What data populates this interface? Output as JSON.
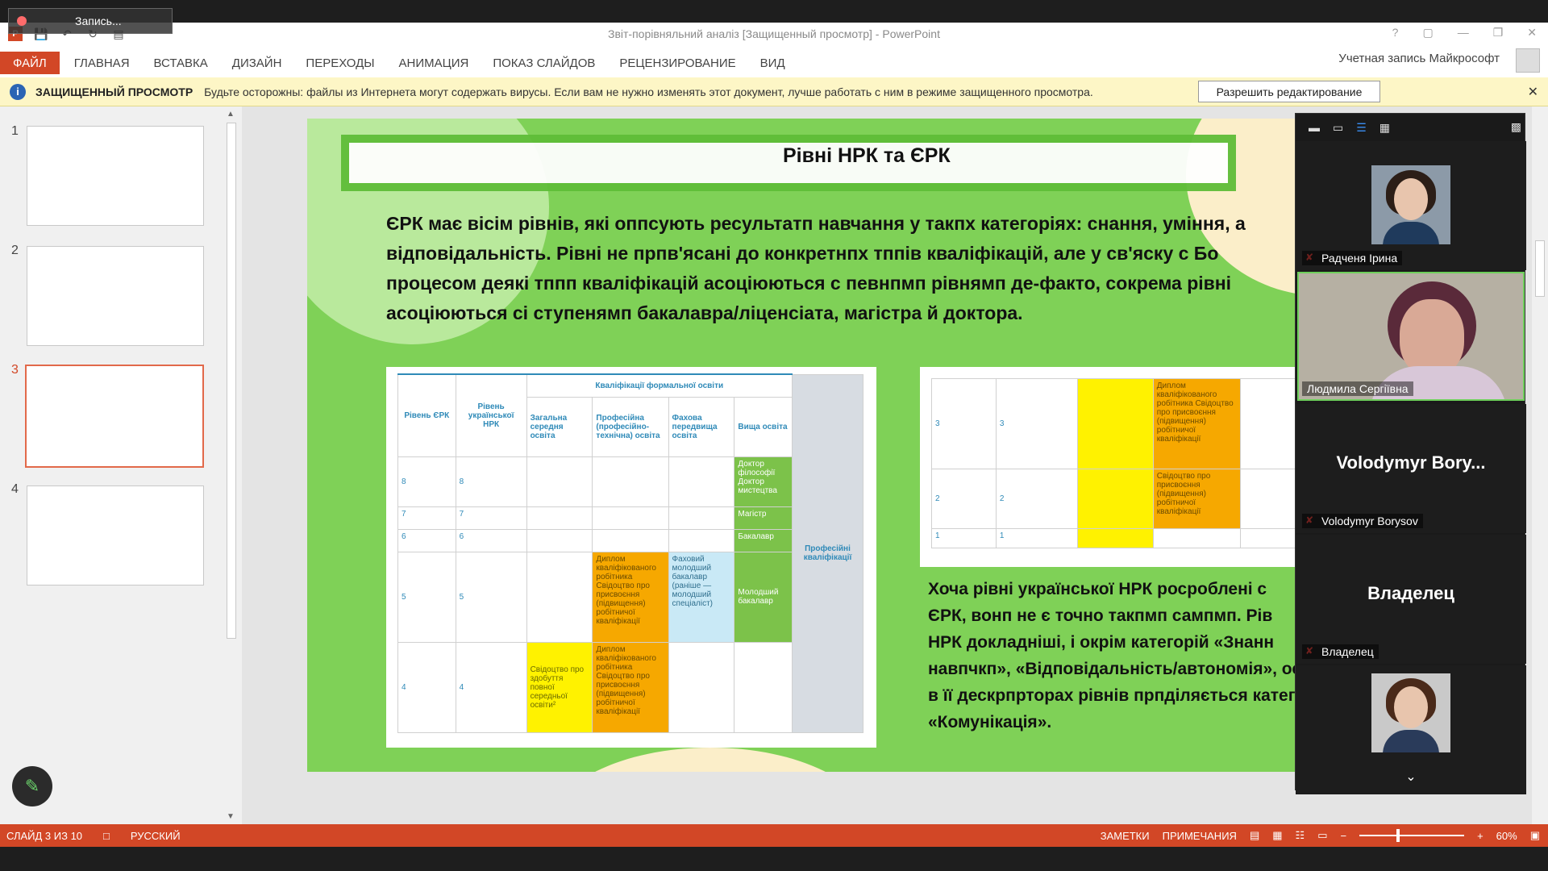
{
  "window": {
    "title": "Звіт-порівняльний аналіз [Защищенный просмотр] - PowerPoint",
    "recording_label": "Запись..."
  },
  "ribbon": {
    "file": "ФАЙЛ",
    "tabs": [
      "ГЛАВНАЯ",
      "ВСТАВКА",
      "ДИЗАЙН",
      "ПЕРЕХОДЫ",
      "АНИМАЦИЯ",
      "ПОКАЗ СЛАЙДОВ",
      "РЕЦЕНЗИРОВАНИЕ",
      "ВИД"
    ],
    "account": "Учетная запись Майкрософт"
  },
  "protected_view": {
    "title": "ЗАЩИЩЕННЫЙ ПРОСМОТР",
    "message": "Будьте осторожны: файлы из Интернета могут содержать вирусы. Если вам не нужно изменять этот документ, лучше работать с ним в режиме защищенного просмотра.",
    "button": "Разрешить редактирование"
  },
  "thumbnails": [
    "1",
    "2",
    "3",
    "4"
  ],
  "slide": {
    "title": "Рівні НРК та ЄРК",
    "paragraph1": [
      "ЄРК має вісім рівнів, які оппсують ресультатп навчання у такпх категоріях: снання, уміння, а",
      "відповідальність. Рівні не прпв'ясані до конкретнпх тппів кваліфікацій, але у св'яску с Бо",
      "процесом деякі тппп кваліфікацій асоціюються с певнпмп рівнямп де-факто, сокрема рівні",
      "асоціюються сі ступенямп бакалавра/ліценсіата, магістра й доктора."
    ],
    "paragraph2": [
      "Хоча рівні української НРК росроблені с",
      "ЄРК, вонп не є точно такпмп сампмп. Рів",
      "НРК докладніші, і окрім категорій «Знанн",
      "навпчкп», «Відповідальність/автономія», ос",
      "в її дескрпрторах рівнів прпділяється катего",
      "«Комунікація»."
    ],
    "table1": {
      "h_erk": "Рівень ЄРК",
      "h_nrk": "Рівень української НРК",
      "h_formal": "Кваліфікації формальної освіти",
      "h_general": "Загальна середня освіта",
      "h_vocational": "Професійна (професійно-технічна) освіта",
      "h_prehigher": "Фахова передвища освіта",
      "h_higher": "Вища освіта",
      "h_prof": "Професійні кваліфікації",
      "rows": [
        {
          "erk": "8",
          "nrk": "8",
          "higher": "Доктор філософії Доктор мистецтва"
        },
        {
          "erk": "7",
          "nrk": "7",
          "higher": "Магістр"
        },
        {
          "erk": "6",
          "nrk": "6",
          "higher": "Бакалавр"
        },
        {
          "erk": "5",
          "nrk": "5",
          "vocational": "Диплом кваліфікованого робітника Свідоцтво про присвоєння (підвищення) робітничої кваліфікації",
          "prehigher": "Фаховий молодший бакалавр (раніше — молодший спеціаліст)",
          "higher": "Молодший бакалавр"
        },
        {
          "erk": "4",
          "nrk": "4",
          "general": "Свідоцтво про здобуття повної середньої освіти²",
          "vocational": "Диплом кваліфікованого робітника Свідоцтво про присвоєння (підвищення) робітничої кваліфікації"
        }
      ]
    },
    "table2": {
      "rows": [
        {
          "erk": "3",
          "nrk": "3",
          "vocational": "Диплом кваліфікованого робітника Свідоцтво про присвоєння (підвищення) робітничої кваліфікації"
        },
        {
          "erk": "2",
          "nrk": "2",
          "vocational": "Свідоцтво про присвоєння (підвищення) робітничої кваліфікації"
        },
        {
          "erk": "1",
          "nrk": "1",
          "vocational": ""
        }
      ]
    }
  },
  "participants": [
    {
      "name": "Радченя Ірина"
    },
    {
      "name": "Людмила Сергіївна"
    },
    {
      "name": "Volodymyr Borysov",
      "display": "Volodymyr Bory..."
    },
    {
      "name": "Владелец",
      "display": "Владелец"
    }
  ],
  "statusbar": {
    "slide": "СЛАЙД 3 ИЗ 10",
    "language": "РУССКИЙ",
    "notes": "ЗАМЕТКИ",
    "comments": "ПРИМЕЧАНИЯ",
    "zoom": "60%"
  },
  "colors": {
    "accent": "#d24726",
    "slide_bg": "#7fd157",
    "info": "#fdf6c6"
  }
}
